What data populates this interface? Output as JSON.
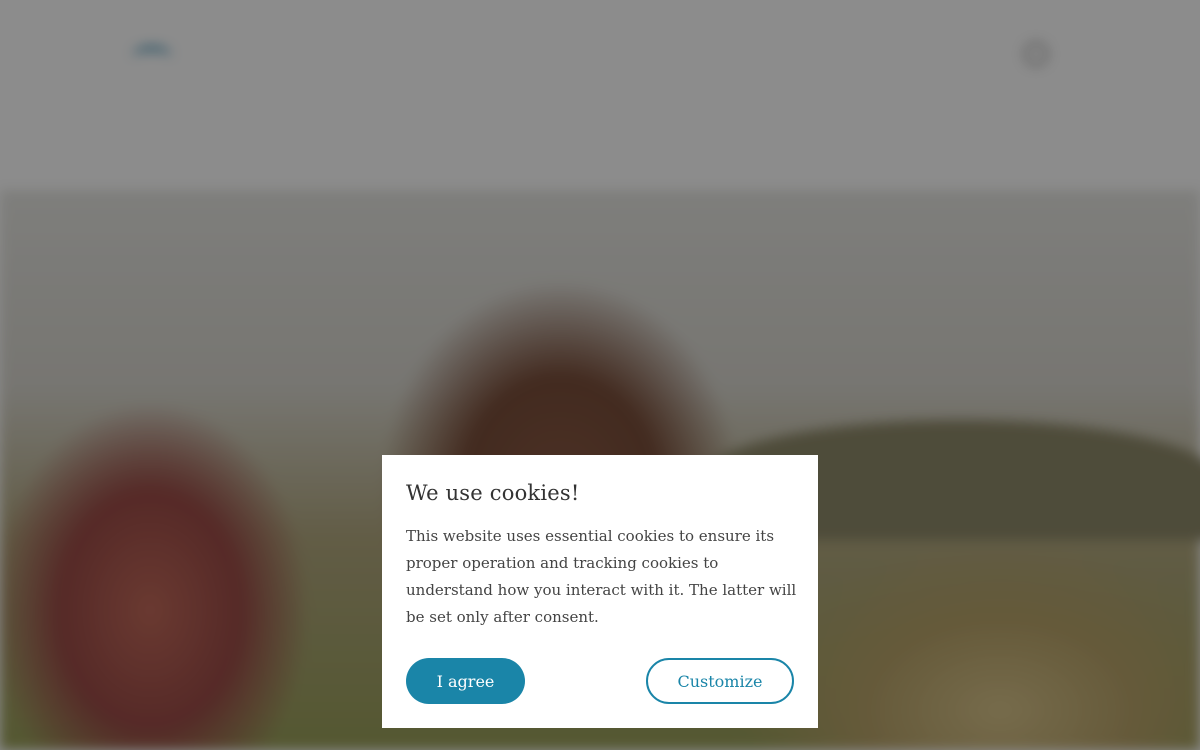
{
  "cookie_dialog": {
    "title": "We use cookies!",
    "body": "This website uses essential cookies to ensure its proper operation and tracking cookies to understand how you interact with it. The latter will be set only after consent.",
    "agree_label": "I agree",
    "customize_label": "Customize"
  },
  "colors": {
    "accent": "#1a85a8",
    "overlay": "rgba(0,0,0,0.45)"
  }
}
